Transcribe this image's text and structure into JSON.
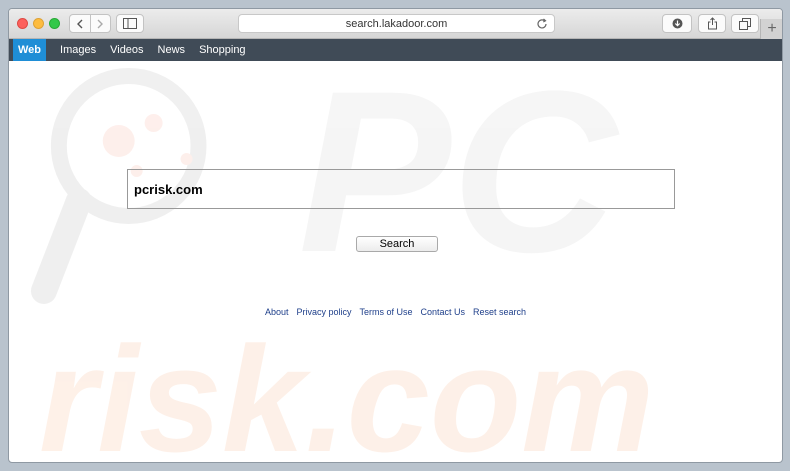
{
  "browser": {
    "url": "search.lakadoor.com",
    "new_tab_symbol": "+",
    "icons": [
      "back-icon",
      "forward-icon",
      "sidebar-icon",
      "reload-icon",
      "download-icon",
      "share-icon",
      "tabs-icon"
    ]
  },
  "nav": {
    "items": [
      {
        "label": "Web",
        "active": true
      },
      {
        "label": "Images"
      },
      {
        "label": "Videos"
      },
      {
        "label": "News"
      },
      {
        "label": "Shopping"
      }
    ],
    "bar_color": "#404b57",
    "active_color": "#1f8ed6"
  },
  "search": {
    "value": "pcrisk.com",
    "button_label": "Search"
  },
  "footer": {
    "links": [
      "About",
      "Privacy policy",
      "Terms of Use",
      "Contact Us",
      "Reset search"
    ]
  },
  "watermark": {
    "line1": "PC",
    "line2": "risk.com"
  }
}
